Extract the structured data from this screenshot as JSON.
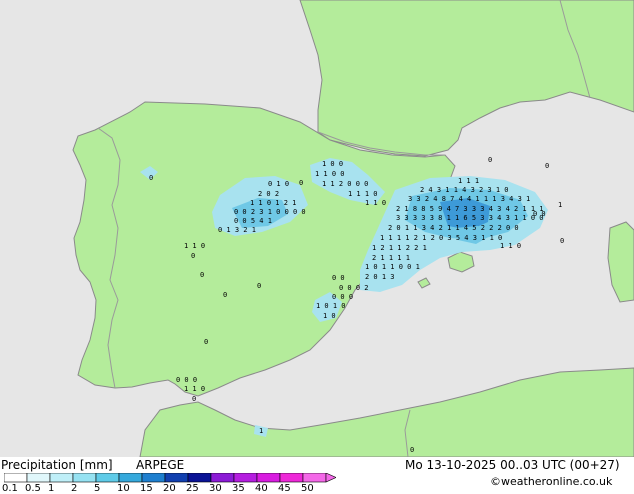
{
  "header": {
    "title": "Precipitation [mm]",
    "model": "ARPEGE",
    "valid_time": "Mo 13-10-2025 00..03 UTC (00+27)",
    "credit": "©weatheronline.co.uk"
  },
  "colors": {
    "sea": "#e6e6e6",
    "land": "#b4ec9b",
    "coast": "#8a8a8a",
    "border": "#9a9a9a",
    "precip_light": "#a8e2ef",
    "precip_mid": "#6fc8e6",
    "precip_heavy": "#3d9ad8"
  },
  "legend": {
    "ticks": [
      "0.1",
      "0.5",
      "1",
      "2",
      "5",
      "10",
      "15",
      "20",
      "25",
      "30",
      "35",
      "40",
      "45",
      "50"
    ],
    "bins": [
      {
        "color": "#ffffff"
      },
      {
        "color": "#e0f7fb"
      },
      {
        "color": "#bfeff8"
      },
      {
        "color": "#96e2f2"
      },
      {
        "color": "#5fcbe8"
      },
      {
        "color": "#35a9dc"
      },
      {
        "color": "#1e7fcf"
      },
      {
        "color": "#1140b0"
      },
      {
        "color": "#0a1395"
      },
      {
        "color": "#8c1bd6"
      },
      {
        "color": "#b51ee0"
      },
      {
        "color": "#d81ce0"
      },
      {
        "color": "#ee28d8"
      },
      {
        "color": "#f468e8"
      }
    ]
  },
  "map": {
    "precip_labels": [
      {
        "row": "1 0 0"
      },
      {
        "row": "1 1   0 0"
      },
      {
        "row": "1 1 2 0 0 0"
      },
      {
        "row": "1 1 1 0"
      },
      {
        "row": "1 1 0"
      },
      {
        "row": "0 1 0"
      },
      {
        "row": "2   0 2"
      },
      {
        "row": "1   1 0 1 2 1"
      },
      {
        "row": "0 0 2 3 1 0 0 0 0"
      },
      {
        "row": "0 0 5 4 1"
      },
      {
        "row": "0 1 3 2 1"
      },
      {
        "row": "1 1 0"
      },
      {
        "row": "0"
      },
      {
        "row": "1 1 1"
      },
      {
        "row": "2 4 3 1 1 4 3 2 3 1 0"
      },
      {
        "row": "3 3 2 4 8 7 4 4 1 1 1 3 4 3 1"
      },
      {
        "row": "2 1 8 8 5 9 4 7 3 3 3 4 3 4 2 1 1 1"
      },
      {
        "row": "3 3 3 3 3 8 1 1 6 5 3 3 4 3 1 1 0 0"
      },
      {
        "row": "2 0 1 1 3 4 2 1 1 4 5 2 2 2 0 0"
      },
      {
        "row": "1 1 1 1 2 1 2 0   3 5 4 3   1 1 0"
      },
      {
        "row": "1 2 1 1 2 2   1"
      },
      {
        "row": "2 1 1 1 1"
      },
      {
        "row": "1 0 1 1 0   0 1"
      },
      {
        "row": "2   0 1 3"
      },
      {
        "row": "0 0"
      },
      {
        "row": "0 0 0 2"
      },
      {
        "row": "0   0 0"
      },
      {
        "row": "1 0 1 0"
      },
      {
        "row": "1 0"
      },
      {
        "row": "0 0 0"
      },
      {
        "row": "1 1 0"
      },
      {
        "row": "0"
      },
      {
        "row": "1"
      },
      {
        "row": "0"
      },
      {
        "row": "0"
      },
      {
        "row": "0"
      },
      {
        "row": "0"
      },
      {
        "row": "0"
      },
      {
        "row": "0"
      },
      {
        "row": "0"
      },
      {
        "row": "0"
      },
      {
        "row": "0 0"
      },
      {
        "row": "0"
      },
      {
        "row": "1 1 0"
      },
      {
        "row": "1"
      },
      {
        "row": "0"
      }
    ]
  }
}
